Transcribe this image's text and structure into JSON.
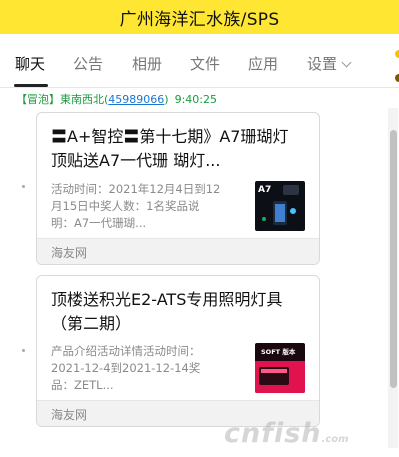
{
  "window": {
    "title": "广州海洋汇水族/SPS"
  },
  "tabs": [
    {
      "label": "聊天",
      "active": true
    },
    {
      "label": "公告"
    },
    {
      "label": "相册"
    },
    {
      "label": "文件"
    },
    {
      "label": "应用"
    },
    {
      "label": "设置"
    }
  ],
  "message": {
    "tag": "【冒泡】",
    "sender": "東南西北",
    "qq_open": "(",
    "qq": "45989066",
    "qq_close": ")",
    "time": "9:40:25"
  },
  "cards": [
    {
      "title": "〓A+智控〓第十七期》A7珊瑚灯顶贴送A7一代珊 瑚灯...",
      "description": "活动时间：2021年12月4日到12月15日中奖人数：1名奖品说明：A7一代珊瑚...",
      "thumbnail_text": "A7",
      "source": "海友网"
    },
    {
      "title": "顶楼送积光E2-ATS专用照明灯具（第二期）",
      "description": "产品介绍活动详情活动时间：2021-12-4到2021-12-14奖品：ZETL...",
      "thumbnail_text": "SOFT 版本",
      "source": "海友网"
    }
  ],
  "watermark": {
    "text": "cnfish",
    "suffix": ".com"
  },
  "colors": {
    "titlebar": "#ffe633",
    "sender": "#1a9b3e",
    "link": "#1976d2"
  }
}
